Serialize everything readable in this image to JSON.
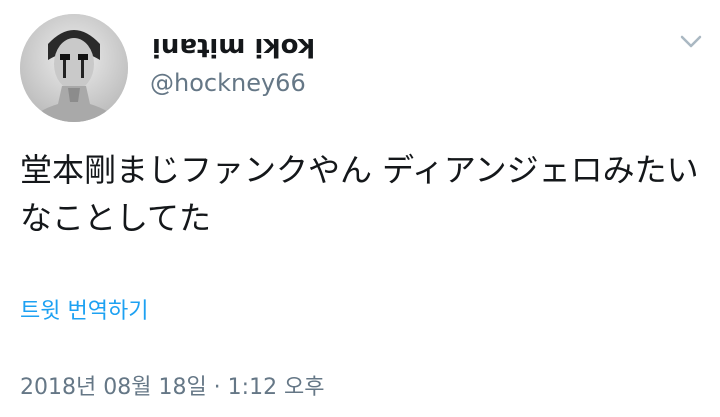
{
  "tweet": {
    "author": {
      "display_name": "koki mitani",
      "handle": "@hockney66",
      "avatar_icon": "profile-photo"
    },
    "caret_icon": "chevron-down-icon",
    "text": "堂本剛まじファンクやん ディアンジェロみたいなことしてた",
    "translate_label": "트윗 번역하기",
    "timestamp": "2018년 08월 18일 · 1:12 오후"
  },
  "colors": {
    "text": "#14171a",
    "secondary": "#657786",
    "link": "#1da1f2",
    "caret": "#aab8c2"
  }
}
